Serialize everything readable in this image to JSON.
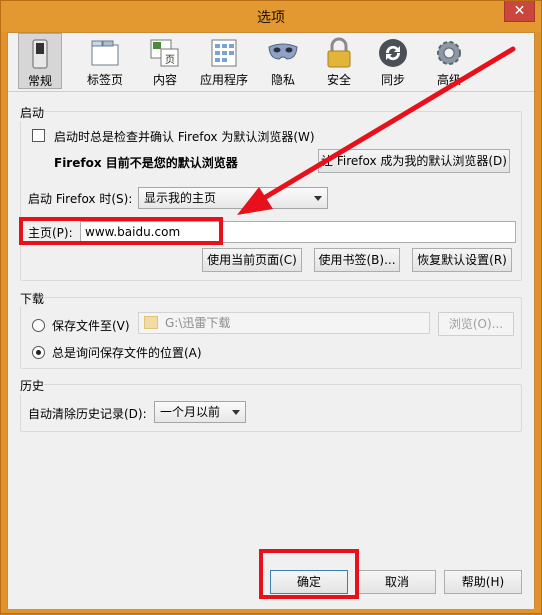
{
  "window": {
    "title": "选项",
    "close_glyph": "✕"
  },
  "toolbar": {
    "items": [
      {
        "label": "常规",
        "icon": "switch-icon"
      },
      {
        "label": "标签页",
        "icon": "tabs-icon"
      },
      {
        "label": "内容",
        "icon": "content-icon"
      },
      {
        "label": "应用程序",
        "icon": "applications-icon"
      },
      {
        "label": "隐私",
        "icon": "mask-icon"
      },
      {
        "label": "安全",
        "icon": "lock-icon"
      },
      {
        "label": "同步",
        "icon": "sync-icon"
      },
      {
        "label": "高级",
        "icon": "gear-icon"
      }
    ],
    "content_icon_text": "页"
  },
  "startup": {
    "group_label": "启动",
    "check_default_label": "启动时总是检查并确认 Firefox 为默认浏览器(W)",
    "not_default_text": "Firefox 目前不是您的默认浏览器",
    "make_default_button": "让 Firefox 成为我的默认浏览器(D)",
    "when_starts_label": "启动 Firefox 时(S):",
    "when_starts_value": "显示我的主页",
    "homepage_label": "主页(P):",
    "homepage_value": "www.baidu.com",
    "use_current_button": "使用当前页面(C)",
    "use_bookmark_button": "使用书签(B)...",
    "restore_default_button": "恢复默认设置(R)"
  },
  "downloads": {
    "group_label": "下载",
    "save_to_label": "保存文件至(V)",
    "save_path": "G:\\迅雷下载",
    "browse_button": "浏览(O)...",
    "always_ask_label": "总是询问保存文件的位置(A)"
  },
  "history": {
    "group_label": "历史",
    "auto_clear_label": "自动清除历史记录(D):",
    "auto_clear_value": "一个月以前"
  },
  "footer": {
    "ok_button": "确定",
    "cancel_button": "取消",
    "help_button": "帮助(H)"
  },
  "colors": {
    "annotation_red": "#e8101b",
    "window_frame": "#e0922d"
  }
}
